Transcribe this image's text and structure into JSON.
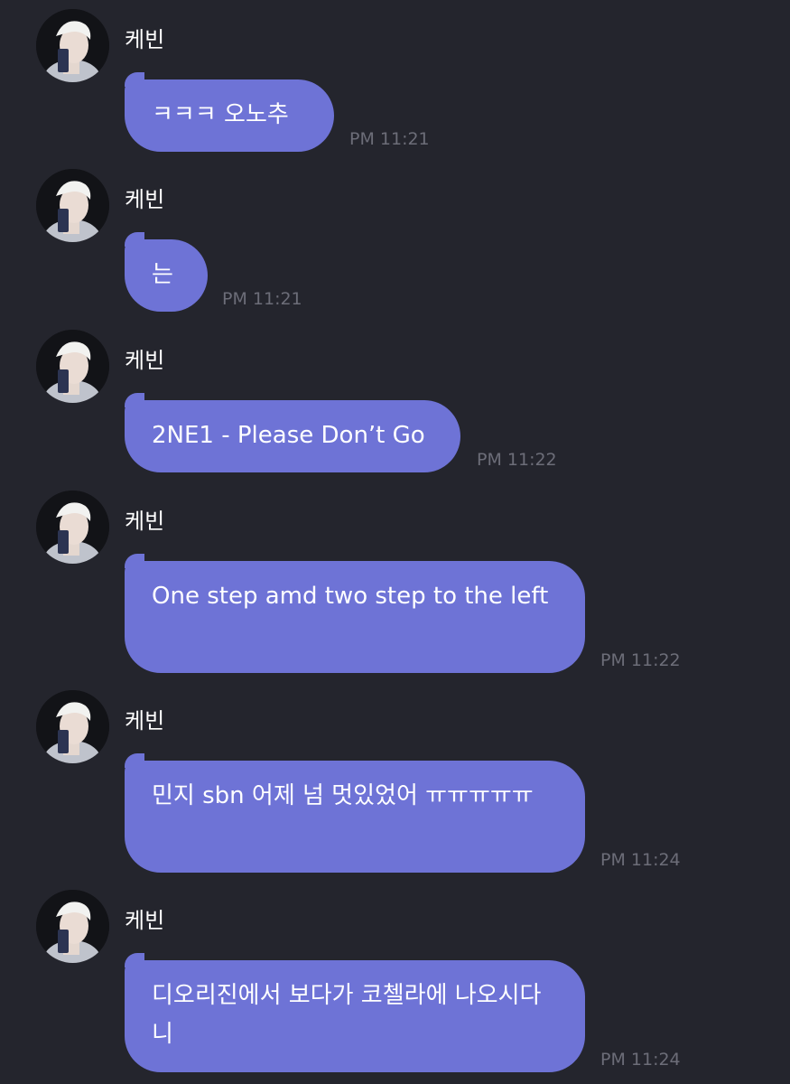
{
  "messages": [
    {
      "sender": "케빈",
      "text": "ㅋㅋㅋ 오노추",
      "time": "PM 11:21"
    },
    {
      "sender": "케빈",
      "text": "는",
      "time": "PM 11:21"
    },
    {
      "sender": "케빈",
      "text": "2NE1 - Please Don’t Go",
      "time": "PM 11:22"
    },
    {
      "sender": "케빈",
      "text": "One step amd two step to the left",
      "time": "PM 11:22"
    },
    {
      "sender": "케빈",
      "text": "민지 sbn 어제 넘 멋있었어 ㅠㅠㅠㅠㅠ",
      "time": "PM 11:24"
    },
    {
      "sender": "케빈",
      "text": "디오리진에서 보다가 코첼라에 나오시다니",
      "time": "PM 11:24"
    }
  ],
  "colors": {
    "background": "#24252d",
    "bubble": "#6e73d6",
    "timestamp": "#6c6d78",
    "sender": "#ffffff"
  }
}
